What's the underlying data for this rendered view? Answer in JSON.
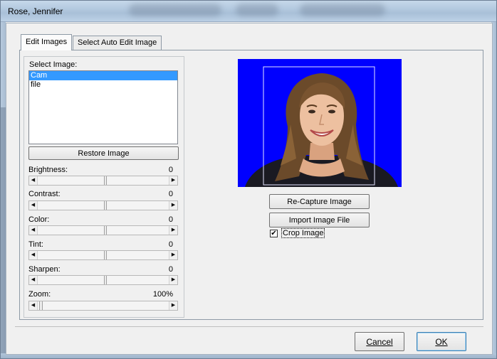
{
  "window": {
    "title": "Rose, Jennifer"
  },
  "tabs": [
    {
      "label": "Edit Images",
      "active": true
    },
    {
      "label": "Select Auto Edit Image",
      "active": false
    }
  ],
  "image_select": {
    "label": "Select Image:",
    "items": [
      {
        "label": "Cam",
        "selected": true
      },
      {
        "label": "file",
        "selected": false
      }
    ]
  },
  "restore_button": "Restore Image",
  "sliders": [
    {
      "label": "Brightness:",
      "value": "0"
    },
    {
      "label": "Contrast:",
      "value": "0"
    },
    {
      "label": "Color:",
      "value": "0"
    },
    {
      "label": "Tint:",
      "value": "0"
    },
    {
      "label": "Sharpen:",
      "value": "0"
    },
    {
      "label": "Zoom:",
      "value": "100%"
    }
  ],
  "recapture_button": "Re-Capture Image",
  "import_button": "Import Image File",
  "crop_checkbox": {
    "label": "Crop Image",
    "checked": true,
    "mark": "✔"
  },
  "footer": {
    "cancel": "Cancel",
    "ok": "OK"
  },
  "colors": {
    "photo_background": "#0000ff",
    "selection": "#3399ff"
  }
}
